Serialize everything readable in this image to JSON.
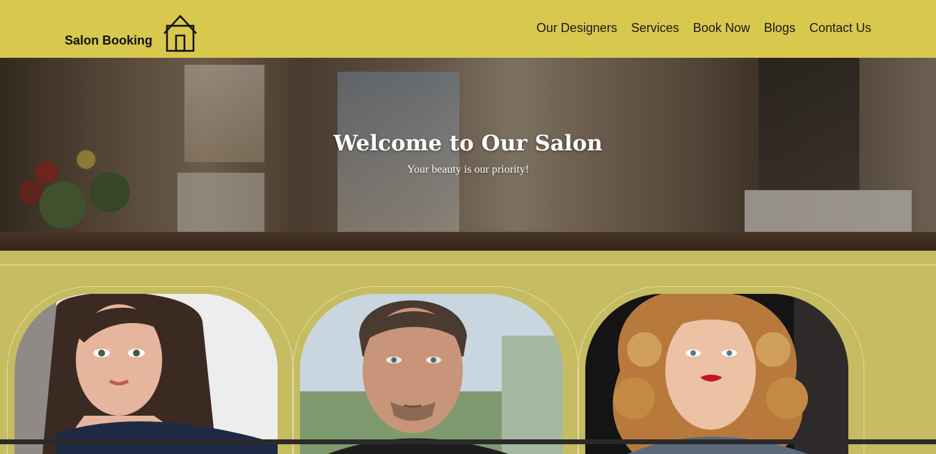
{
  "header": {
    "brand": "Salon Booking",
    "home_icon": "home-icon",
    "nav": [
      "Our Designers",
      "Services",
      "Book Now",
      "Blogs",
      "Contact Us"
    ]
  },
  "hero": {
    "title": "Welcome to Our Salon",
    "subtitle": "Your beauty is our priority!"
  },
  "designers": [
    {
      "photo": "designer-photo-woman-dark-hair"
    },
    {
      "photo": "designer-photo-man-slicked-hair"
    },
    {
      "photo": "designer-photo-woman-curly-blonde-hair"
    }
  ],
  "colors": {
    "header_bg": "#d8c84e",
    "page_bg": "#c6bc62",
    "card_border": "#e2dca6"
  }
}
